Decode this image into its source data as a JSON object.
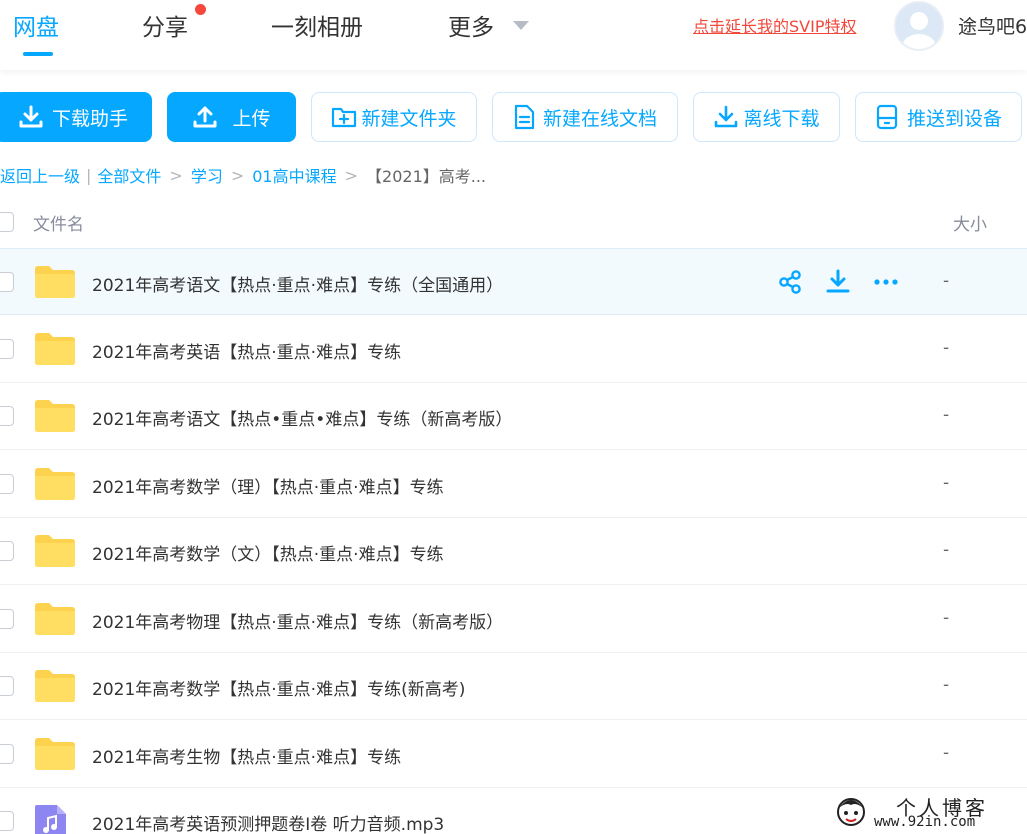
{
  "nav": {
    "tabs": [
      {
        "label": "网盘",
        "active": true
      },
      {
        "label": "分享",
        "badge": true
      },
      {
        "label": "一刻相册"
      },
      {
        "label": "更多"
      }
    ],
    "svip_link": "点击延长我的SVIP特权",
    "username": "途鸟吧6"
  },
  "toolbar": {
    "download_helper": "下载助手",
    "upload": "上传",
    "new_folder": "新建文件夹",
    "new_online_doc": "新建在线文档",
    "offline_download": "离线下载",
    "push_device": "推送到设备"
  },
  "breadcrumb": {
    "back": "返回上一级",
    "all_files": "全部文件",
    "level1": "学习",
    "level2": "01高中课程",
    "current": "【2021】高考..."
  },
  "table": {
    "col_name": "文件名",
    "col_size": "大小",
    "rows": [
      {
        "name": "2021年高考语文【热点·重点·难点】专练（全国通用）",
        "size": "-",
        "type": "folder"
      },
      {
        "name": "2021年高考英语【热点·重点·难点】专练",
        "size": "-",
        "type": "folder"
      },
      {
        "name": "2021年高考语文【热点•重点•难点】专练（新高考版）",
        "size": "-",
        "type": "folder"
      },
      {
        "name": "2021年高考数学（理）【热点·重点·难点】专练",
        "size": "-",
        "type": "folder"
      },
      {
        "name": "2021年高考数学（文）【热点·重点·难点】专练",
        "size": "-",
        "type": "folder"
      },
      {
        "name": "2021年高考物理【热点·重点·难点】专练（新高考版）",
        "size": "-",
        "type": "folder"
      },
      {
        "name": "2021年高考数学【热点·重点·难点】专练(新高考)",
        "size": "-",
        "type": "folder"
      },
      {
        "name": "2021年高考生物【热点·重点·难点】专练",
        "size": "-",
        "type": "folder"
      },
      {
        "name": "2021年高考英语预测押题卷I卷 听力音频.mp3",
        "size": "",
        "type": "audio"
      }
    ]
  },
  "watermark": {
    "title": "个人博客",
    "url": "www.92in.com"
  },
  "colors": {
    "accent": "#06a7ff",
    "svip": "#f2483b",
    "folder": "#fdd24f",
    "audio": "#8d86f2"
  }
}
